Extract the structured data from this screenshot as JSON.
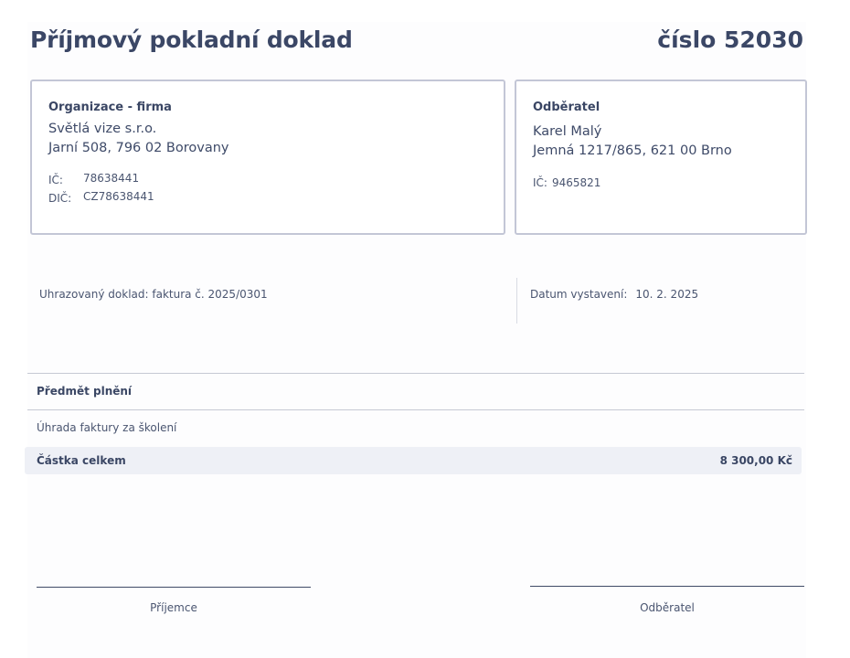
{
  "document": {
    "title": "Příjmový pokladní doklad",
    "number": "číslo 52030"
  },
  "organization": {
    "heading": "Organizace - firma",
    "name": "Světlá vize s.r.o.",
    "address": "Jarní 508, 796 02 Borovany",
    "ic_label": "IČ:",
    "ic_value": "78638441",
    "dic_label": "DIČ:",
    "dic_value": "CZ78638441"
  },
  "customer": {
    "heading": "Odběratel",
    "name": "Karel Malý",
    "address": "Jemná 1217/865, 621 00 Brno",
    "ic_label": "IČ:",
    "ic_value": "9465821"
  },
  "info": {
    "paid_document": "Uhrazovaný doklad: faktura č. 2025/0301",
    "issue_date_label": "Datum vystavení:",
    "issue_date_value": "10. 2. 2025"
  },
  "subject": {
    "heading": "Předmět plnění",
    "text": "Úhrada faktury za školení"
  },
  "total": {
    "label": "Částka celkem",
    "value": "8 300,00 Kč"
  },
  "signatures": {
    "receiver": "Příjemce",
    "customer": "Odběratel"
  }
}
